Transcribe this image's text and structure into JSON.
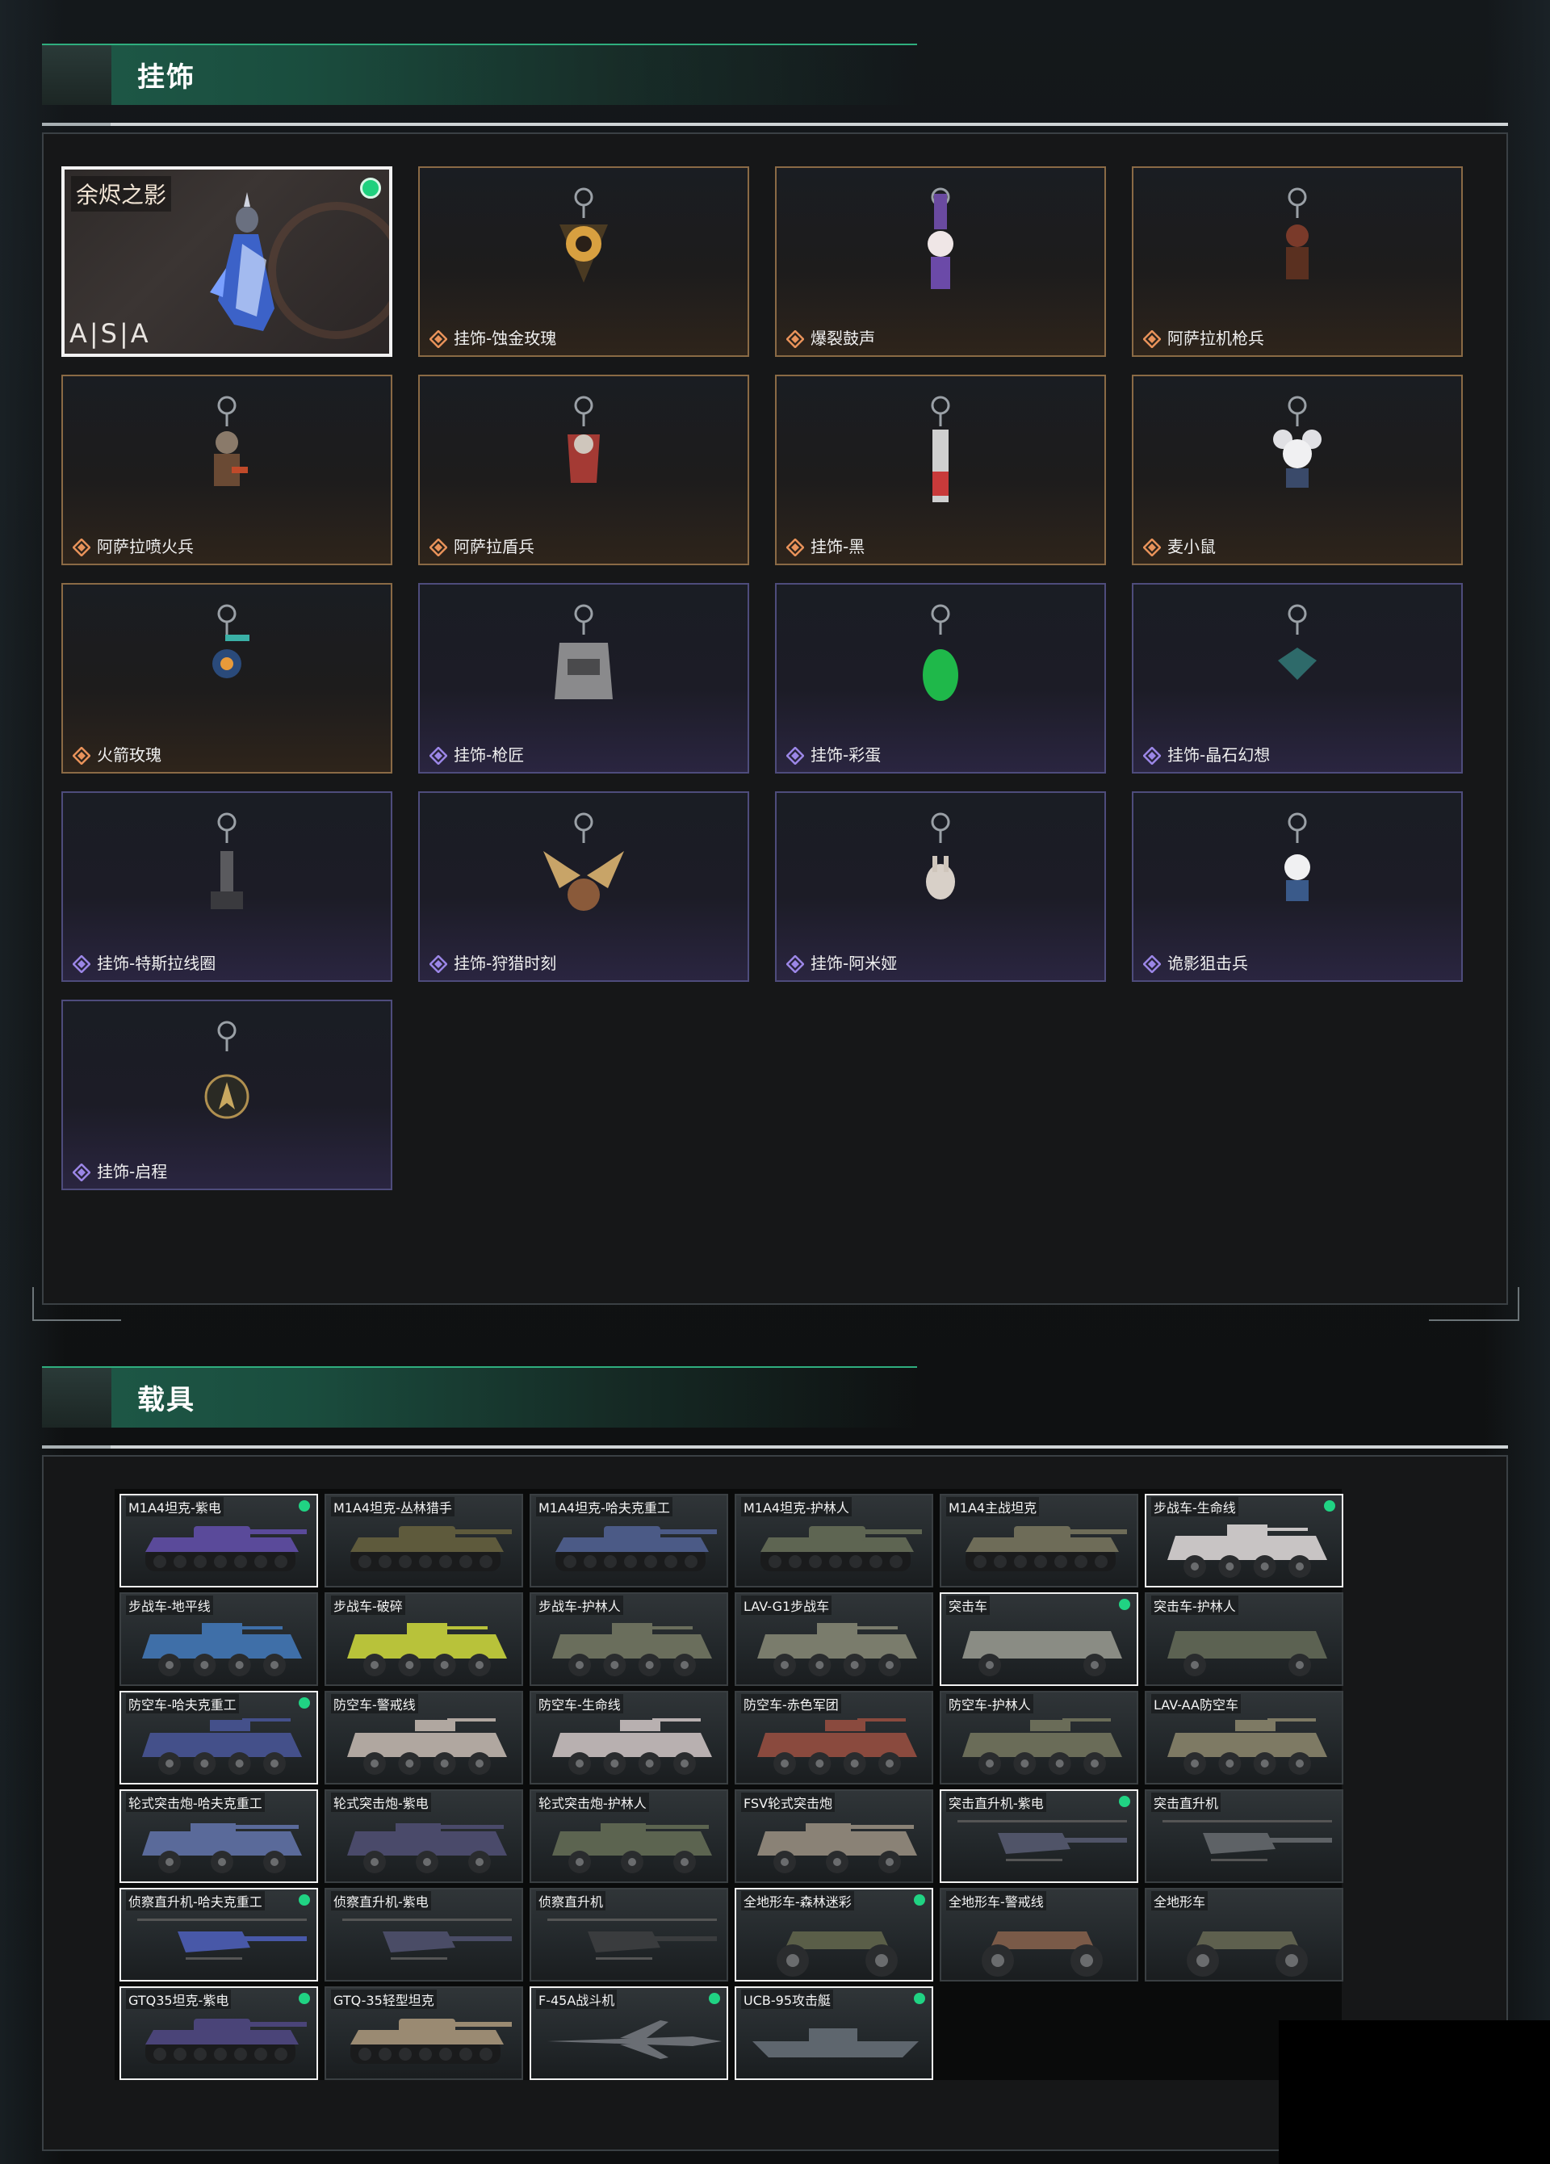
{
  "charms_section": {
    "title": "挂饰",
    "featured": {
      "title": "余烬之影",
      "brand": "A|S|A",
      "equipped": true
    },
    "items": [
      {
        "label": "挂饰-蚀金玫瑰",
        "rarity": "orange",
        "icon": "rose-medallion-charm-icon"
      },
      {
        "label": "爆裂鼓声",
        "rarity": "orange",
        "icon": "drummer-figure-charm-icon"
      },
      {
        "label": "阿萨拉机枪兵",
        "rarity": "orange",
        "icon": "gunner-figure-charm-icon"
      },
      {
        "label": "阿萨拉喷火兵",
        "rarity": "orange",
        "icon": "flamethrower-figure-charm-icon"
      },
      {
        "label": "阿萨拉盾兵",
        "rarity": "orange",
        "icon": "shield-soldier-charm-icon"
      },
      {
        "label": "挂饰-黑",
        "rarity": "orange",
        "icon": "syringe-charm-icon"
      },
      {
        "label": "麦小鼠",
        "rarity": "orange",
        "icon": "mouse-charm-icon"
      },
      {
        "label": "火箭玫瑰",
        "rarity": "orange",
        "icon": "rocket-figure-charm-icon"
      },
      {
        "label": "挂饰-枪匠",
        "rarity": "purple",
        "icon": "gunsmith-tag-charm-icon"
      },
      {
        "label": "挂饰-彩蛋",
        "rarity": "purple",
        "icon": "green-egg-charm-icon"
      },
      {
        "label": "挂饰-晶石幻想",
        "rarity": "purple",
        "icon": "crystal-cube-charm-icon"
      },
      {
        "label": "挂饰-特斯拉线圈",
        "rarity": "purple",
        "icon": "tesla-coil-charm-icon"
      },
      {
        "label": "挂饰-狩猎时刻",
        "rarity": "purple",
        "icon": "antler-charm-icon"
      },
      {
        "label": "挂饰-阿米娅",
        "rarity": "purple",
        "icon": "bunny-charm-icon"
      },
      {
        "label": "诡影狙击兵",
        "rarity": "purple",
        "icon": "sniper-figure-charm-icon"
      },
      {
        "label": "挂饰-启程",
        "rarity": "purple",
        "icon": "compass-medallion-charm-icon"
      }
    ]
  },
  "vehicles_section": {
    "title": "载具",
    "items": [
      {
        "label": "M1A4坦克-紫电",
        "kind": "tank",
        "color": "#5a4a9a",
        "selected": true,
        "equipped": true
      },
      {
        "label": "M1A4坦克-丛林猎手",
        "kind": "tank",
        "color": "#5e5a3c",
        "selected": false,
        "equipped": false
      },
      {
        "label": "M1A4坦克-哈夫克重工",
        "kind": "tank",
        "color": "#4b5a86",
        "selected": false,
        "equipped": false
      },
      {
        "label": "M1A4坦克-护林人",
        "kind": "tank",
        "color": "#5e6552",
        "selected": false,
        "equipped": false
      },
      {
        "label": "M1A4主战坦克",
        "kind": "tank",
        "color": "#6e6c58",
        "selected": false,
        "equipped": false
      },
      {
        "label": "步战车-生命线",
        "kind": "ifv",
        "color": "#c8c4c4",
        "selected": true,
        "equipped": true
      },
      {
        "label": "步战车-地平线",
        "kind": "ifv",
        "color": "#3f6fa8",
        "selected": false,
        "equipped": false
      },
      {
        "label": "步战车-破碎",
        "kind": "ifv",
        "color": "#b8c23a",
        "selected": false,
        "equipped": false
      },
      {
        "label": "步战车-护林人",
        "kind": "ifv",
        "color": "#6a6e5c",
        "selected": false,
        "equipped": false
      },
      {
        "label": "LAV-G1步战车",
        "kind": "ifv",
        "color": "#7a7c6c",
        "selected": false,
        "equipped": false
      },
      {
        "label": "突击车",
        "kind": "suv",
        "color": "#8a8c84",
        "selected": true,
        "equipped": true
      },
      {
        "label": "突击车-护林人",
        "kind": "suv",
        "color": "#5c6252",
        "selected": false,
        "equipped": false
      },
      {
        "label": "防空车-哈夫克重工",
        "kind": "aa",
        "color": "#44508a",
        "selected": true,
        "equipped": true
      },
      {
        "label": "防空车-警戒线",
        "kind": "aa",
        "color": "#b0a7a0",
        "selected": false,
        "equipped": false
      },
      {
        "label": "防空车-生命线",
        "kind": "aa",
        "color": "#b8b0b0",
        "selected": false,
        "equipped": false
      },
      {
        "label": "防空车-赤色军团",
        "kind": "aa",
        "color": "#8a4a3e",
        "selected": false,
        "equipped": false
      },
      {
        "label": "防空车-护林人",
        "kind": "aa",
        "color": "#6a6c58",
        "selected": false,
        "equipped": false
      },
      {
        "label": "LAV-AA防空车",
        "kind": "aa",
        "color": "#7e7a64",
        "selected": false,
        "equipped": false
      },
      {
        "label": "轮式突击炮-哈夫克重工",
        "kind": "gun",
        "color": "#5a6a9a",
        "selected": true,
        "equipped": false
      },
      {
        "label": "轮式突击炮-紫电",
        "kind": "gun",
        "color": "#4a4a6a",
        "selected": false,
        "equipped": false
      },
      {
        "label": "轮式突击炮-护林人",
        "kind": "gun",
        "color": "#5c6450",
        "selected": false,
        "equipped": false
      },
      {
        "label": "FSV轮式突击炮",
        "kind": "gun",
        "color": "#8a8276",
        "selected": false,
        "equipped": false
      },
      {
        "label": "突击直升机-紫电",
        "kind": "heli",
        "color": "#505468",
        "selected": true,
        "equipped": true
      },
      {
        "label": "突击直升机",
        "kind": "heli",
        "color": "#5e6266",
        "selected": false,
        "equipped": false
      },
      {
        "label": "侦察直升机-哈夫克重工",
        "kind": "scout",
        "color": "#4858a8",
        "selected": true,
        "equipped": true
      },
      {
        "label": "侦察直升机-紫电",
        "kind": "scout",
        "color": "#4a4c66",
        "selected": false,
        "equipped": false
      },
      {
        "label": "侦察直升机",
        "kind": "scout",
        "color": "#3a3c3e",
        "selected": false,
        "equipped": false
      },
      {
        "label": "全地形车-森林迷彩",
        "kind": "atv",
        "color": "#5a5e48",
        "selected": true,
        "equipped": true
      },
      {
        "label": "全地形车-警戒线",
        "kind": "atv",
        "color": "#7a5a48",
        "selected": false,
        "equipped": false
      },
      {
        "label": "全地形车",
        "kind": "atv",
        "color": "#5e604e",
        "selected": false,
        "equipped": false
      },
      {
        "label": "GTQ35坦克-紫电",
        "kind": "tank",
        "color": "#4a4478",
        "selected": true,
        "equipped": true
      },
      {
        "label": "GTQ-35轻型坦克",
        "kind": "tank",
        "color": "#9a8a72",
        "selected": false,
        "equipped": false
      },
      {
        "label": "F-45A战斗机",
        "kind": "jet",
        "color": "#6a6e74",
        "selected": true,
        "equipped": true
      },
      {
        "label": "UCB-95攻击艇",
        "kind": "boat",
        "color": "#5e666e",
        "selected": true,
        "equipped": true
      }
    ]
  },
  "colors": {
    "accent_green": "#1fd07e",
    "rarity_orange": "#e8925a",
    "rarity_purple": "#9b86e6"
  }
}
